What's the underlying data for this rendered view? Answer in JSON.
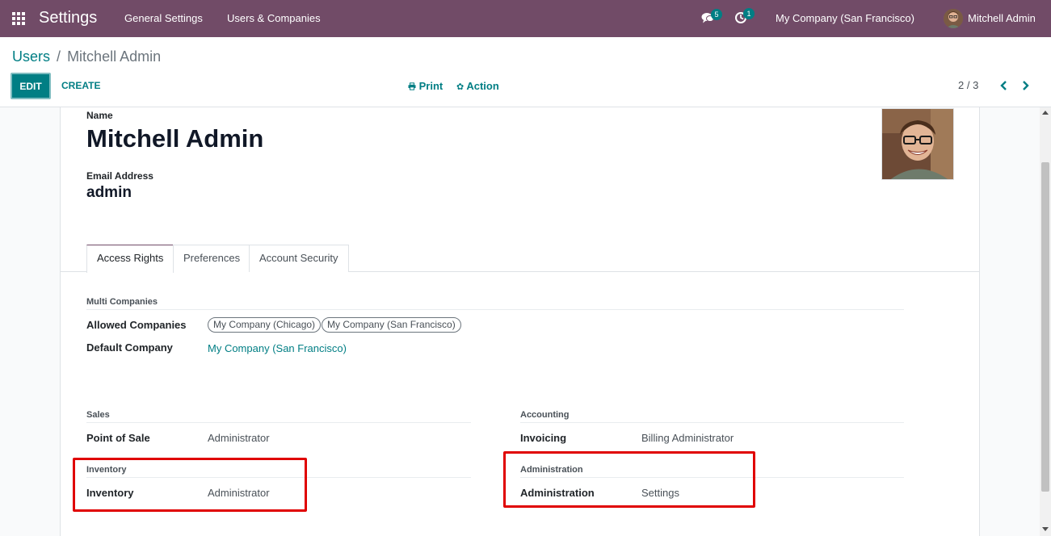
{
  "navbar": {
    "app_title": "Settings",
    "menu": [
      "General Settings",
      "Users & Companies"
    ],
    "messages_count": "5",
    "activities_count": "1",
    "company": "My Company (San Francisco)",
    "user": "Mitchell Admin",
    "icons": [
      "apps-grid-icon",
      "chat-icon",
      "clock-icon",
      "avatar"
    ],
    "color": "#714b67"
  },
  "control_panel": {
    "breadcrumb_parent": "Users",
    "breadcrumb_separator": "/",
    "breadcrumb_current": "Mitchell Admin",
    "edit_label": "EDIT",
    "create_label": "CREATE",
    "print_label": "Print",
    "action_label": "Action",
    "pager": "2 / 3",
    "accent_color": "#017e84"
  },
  "form": {
    "name_label": "Name",
    "name_value": "Mitchell Admin",
    "email_label": "Email Address",
    "email_value": "admin",
    "tabs": [
      "Access Rights",
      "Preferences",
      "Account Security"
    ],
    "active_tab": "Access Rights",
    "multi_companies": {
      "title": "Multi Companies",
      "allowed_label": "Allowed Companies",
      "allowed_tags": [
        "My Company (Chicago)",
        "My Company (San Francisco)"
      ],
      "default_label": "Default Company",
      "default_value": "My Company (San Francisco)"
    },
    "sales": {
      "title": "Sales",
      "field_label": "Point of Sale",
      "field_value": "Administrator"
    },
    "accounting": {
      "title": "Accounting",
      "field_label": "Invoicing",
      "field_value": "Billing Administrator"
    },
    "inventory": {
      "title": "Inventory",
      "field_label": "Inventory",
      "field_value": "Administrator"
    },
    "administration": {
      "title": "Administration",
      "field_label": "Administration",
      "field_value": "Settings"
    },
    "highlight_color": "#e00000"
  }
}
